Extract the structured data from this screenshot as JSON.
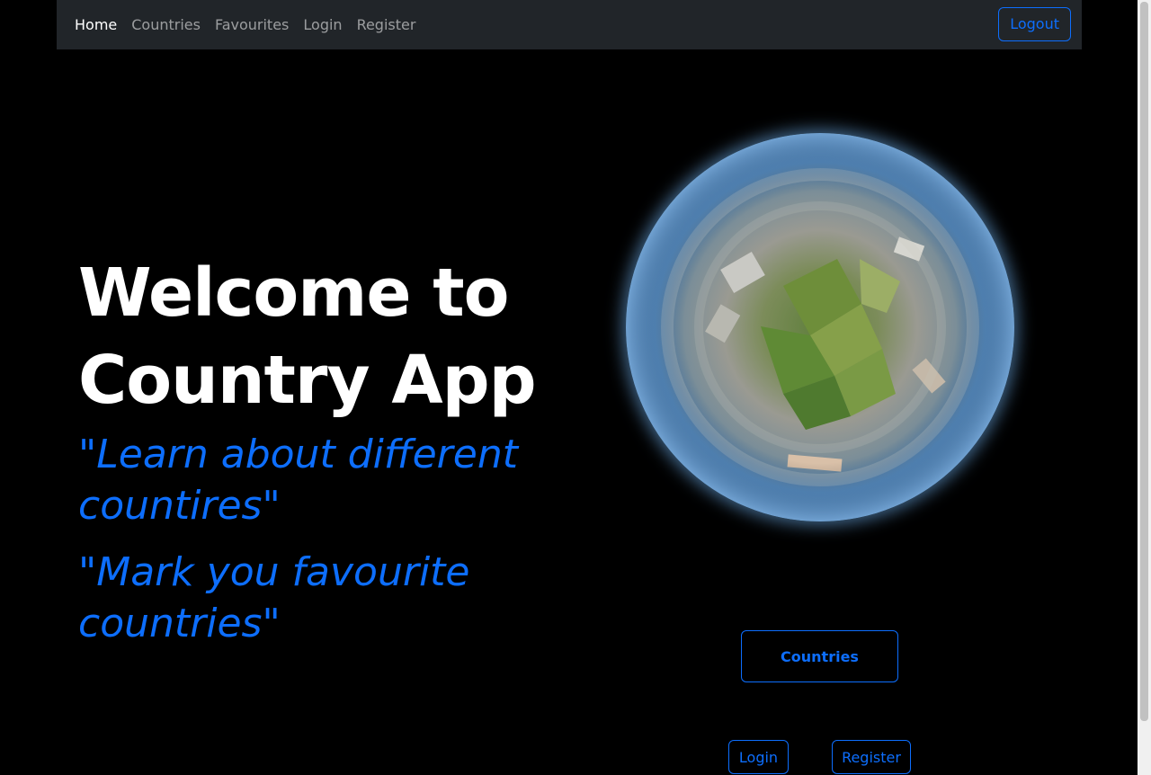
{
  "nav": {
    "items": [
      {
        "label": "Home",
        "active": true
      },
      {
        "label": "Countries",
        "active": false
      },
      {
        "label": "Favourites",
        "active": false
      },
      {
        "label": "Login",
        "active": false
      },
      {
        "label": "Register",
        "active": false
      }
    ],
    "logout_label": "Logout"
  },
  "hero": {
    "title_line1": "Welcome to",
    "title_line2": "Country App",
    "tagline1": "\"Learn about different countires\"",
    "tagline2": "\"Mark you favourite countries\""
  },
  "globe": {
    "icon": "earth-globe-image"
  },
  "actions": {
    "countries_label": "Countries",
    "login_label": "Login",
    "register_label": "Register"
  },
  "colors": {
    "navbar_bg": "#212529",
    "accent": "#0d6efd",
    "page_bg": "#000000"
  }
}
